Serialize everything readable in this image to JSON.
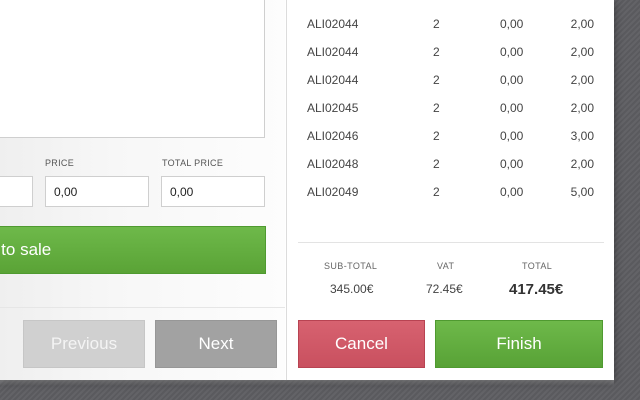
{
  "line_form": {
    "price_label": "PRICE",
    "total_price_label": "TOTAL PRICE",
    "partial_value": "",
    "price_value": "0,00",
    "total_price_value": "0,00",
    "add_button_label": "d to sale"
  },
  "nav": {
    "previous_label": "Previous",
    "next_label": "Next"
  },
  "items": [
    {
      "code": "",
      "qty": "",
      "discount": "",
      "price": ""
    },
    {
      "code": "ALI02044",
      "qty": "2",
      "discount": "0,00",
      "price": "2,00"
    },
    {
      "code": "ALI02044",
      "qty": "2",
      "discount": "0,00",
      "price": "2,00"
    },
    {
      "code": "ALI02044",
      "qty": "2",
      "discount": "0,00",
      "price": "2,00"
    },
    {
      "code": "ALI02045",
      "qty": "2",
      "discount": "0,00",
      "price": "2,00"
    },
    {
      "code": "ALI02046",
      "qty": "2",
      "discount": "0,00",
      "price": "3,00"
    },
    {
      "code": "ALI02048",
      "qty": "2",
      "discount": "0,00",
      "price": "2,00"
    },
    {
      "code": "ALI02049",
      "qty": "2",
      "discount": "0,00",
      "price": "5,00"
    }
  ],
  "totals": {
    "subtotal_label": "SUB-TOTAL",
    "subtotal_value": "345.00€",
    "vat_label": "VAT",
    "vat_value": "72.45€",
    "total_label": "TOTAL",
    "total_value": "417.45€"
  },
  "actions": {
    "cancel_label": "Cancel",
    "finish_label": "Finish"
  },
  "colors": {
    "green": "#5fa93b",
    "red": "#cf5664",
    "grey_button": "#a2a2a2",
    "disabled_button": "#d0d0d0"
  }
}
